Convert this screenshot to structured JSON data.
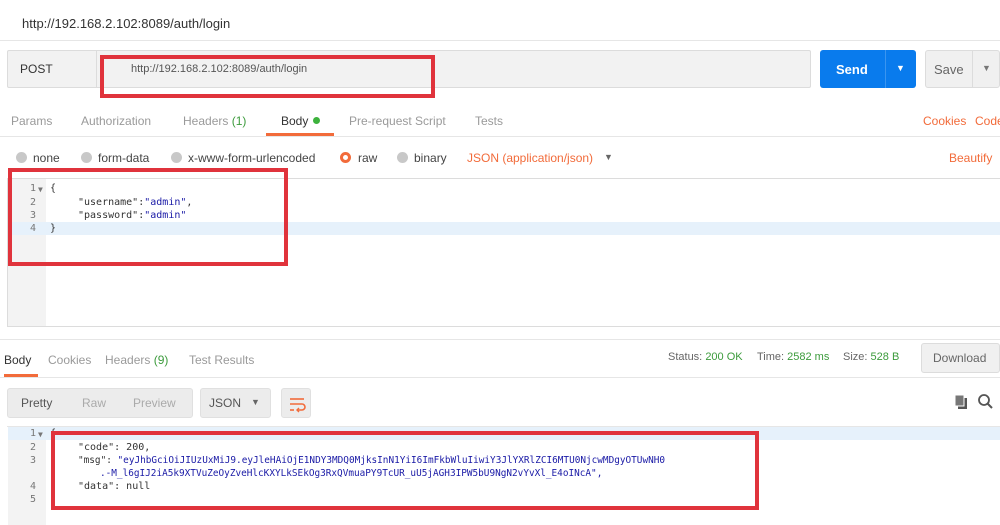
{
  "page_title": "http://192.168.2.102:8089/auth/login",
  "request": {
    "method": "POST",
    "url": "http://192.168.2.102:8089/auth/login",
    "send_label": "Send",
    "save_label": "Save"
  },
  "request_tabs": {
    "params": "Params",
    "authorization": "Authorization",
    "headers": "Headers",
    "headers_count": "(1)",
    "body": "Body",
    "prerequest": "Pre-request Script",
    "tests": "Tests",
    "cookies": "Cookies",
    "code": "Code"
  },
  "body_types": {
    "none": "none",
    "form_data": "form-data",
    "urlencoded": "x-www-form-urlencoded",
    "raw": "raw",
    "binary": "binary",
    "selected_format": "JSON (application/json)",
    "beautify": "Beautify"
  },
  "request_body": {
    "line_numbers": [
      "1",
      "2",
      "3",
      "4"
    ],
    "line1": "{",
    "line2_key": "\"username\"",
    "line2_val": "\"admin\"",
    "line3_key": "\"password\"",
    "line3_val": "\"admin\"",
    "line4": "}"
  },
  "response_tabs": {
    "body": "Body",
    "cookies": "Cookies",
    "headers": "Headers",
    "headers_count": "(9)",
    "test_results": "Test Results"
  },
  "response_meta": {
    "status_label": "Status:",
    "status_value": "200 OK",
    "time_label": "Time:",
    "time_value": "2582 ms",
    "size_label": "Size:",
    "size_value": "528 B",
    "download_label": "Download"
  },
  "response_view": {
    "pretty": "Pretty",
    "raw": "Raw",
    "preview": "Preview",
    "format": "JSON"
  },
  "response_body": {
    "line_numbers": [
      "1",
      "2",
      "3",
      "4",
      "5"
    ],
    "line1": "{",
    "code_key": "\"code\"",
    "code_val": "200,",
    "msg_key": "\"msg\"",
    "msg_val_1": "\"eyJhbGciOiJIUzUxMiJ9.eyJleHAiOjE1NDY3MDQ0MjksInN1YiI6ImFkbWluIiwiY3JlYXRlZCI6MTU0NjcwMDgyOTUwNH0",
    "msg_val_2": ".-M_l6gIJ2iA5k9XTVuZeOyZveHlcKXYLkSEkOg3RxQVmuaPY9TcUR_uU5jAGH3IPW5bU9NgN2vYvXl_E4oINcA\",",
    "data_key": "\"data\"",
    "data_val": "null",
    "line5": "}"
  },
  "colors": {
    "accent": "#f26b3a",
    "send_blue": "#097bed",
    "annotation_red": "#e0333c",
    "status_green": "#3c9b3c"
  }
}
